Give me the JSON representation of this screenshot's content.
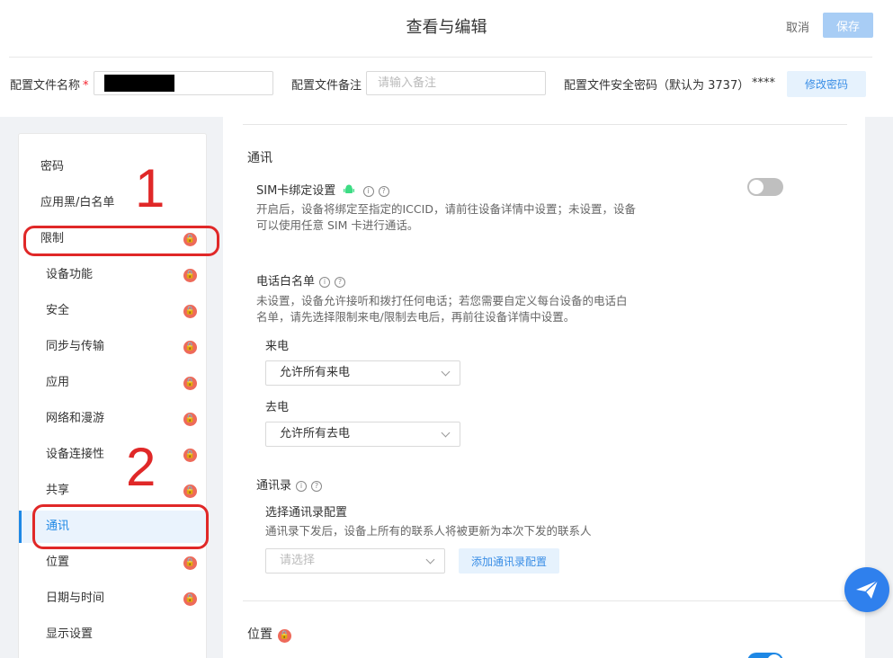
{
  "header": {
    "title": "查看与编辑",
    "cancel_label": "取消",
    "save_label": "保存"
  },
  "config": {
    "name_label": "配置文件名称",
    "required_mark": "*",
    "remark_label": "配置文件备注",
    "remark_placeholder": "请输入备注",
    "password_label": "配置文件安全密码（默认为 3737）",
    "password_mask": "****",
    "change_password_label": "修改密码"
  },
  "sidebar": {
    "items": [
      {
        "label": "密码"
      },
      {
        "label": "应用黑/白名单"
      },
      {
        "label": "限制"
      },
      {
        "label": "设备功能"
      },
      {
        "label": "安全"
      },
      {
        "label": "同步与传输"
      },
      {
        "label": "应用"
      },
      {
        "label": "网络和漫游"
      },
      {
        "label": "设备连接性"
      },
      {
        "label": "共享"
      },
      {
        "label": "通讯"
      },
      {
        "label": "位置"
      },
      {
        "label": "日期与时间"
      },
      {
        "label": "显示设置"
      }
    ],
    "active_label": "通讯"
  },
  "main": {
    "comm_title": "通讯",
    "sim": {
      "title": "SIM卡绑定设置",
      "desc_line1": "开启后，设备将绑定至指定的ICCID，请前往设备详情中设置；未设置，设备",
      "desc_line2": "可以使用任意 SIM 卡进行通话。",
      "enabled": false
    },
    "whitelist": {
      "title": "电话白名单",
      "desc_line1": "未设置，设备允许接听和拨打任何电话；若您需要自定义每台设备的电话白",
      "desc_line2": "名单，请先选择限制来电/限制去电后，再前往设备详情中设置。",
      "incoming_label": "来电",
      "incoming_value": "允许所有来电",
      "outgoing_label": "去电",
      "outgoing_value": "允许所有去电"
    },
    "contacts": {
      "title": "通讯录",
      "subtitle": "选择通讯录配置",
      "desc": "通讯录下发后，设备上所有的联系人将被更新为本次下发的联系人",
      "select_placeholder": "请选择",
      "add_label": "添加通讯录配置"
    },
    "location_title": "位置"
  },
  "annotations": {
    "one": "1",
    "two": "2"
  },
  "colors": {
    "accent": "#1e88e5",
    "annotation": "#e02828",
    "lock_badge": "#ee6a5a",
    "android": "#3ddc84"
  }
}
